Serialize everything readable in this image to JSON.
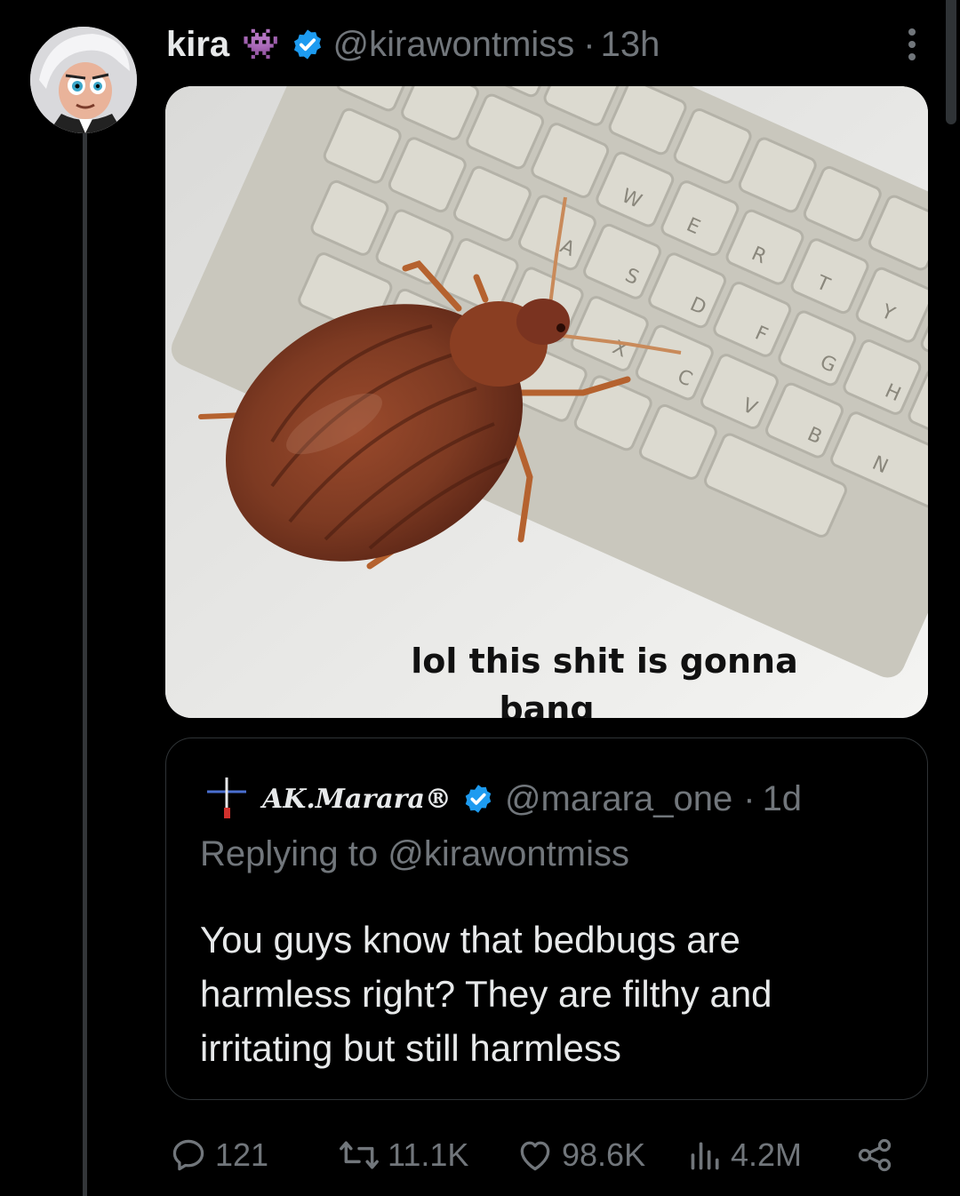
{
  "tweet": {
    "name": "kira",
    "handle": "@kirawontmiss",
    "time_sep": "·",
    "time": "13h",
    "name_emoji": "👾",
    "verified": true,
    "media": {
      "caption_line1": "lol this shit is gonna",
      "caption_line2": "bang"
    }
  },
  "quote": {
    "name": "AK.Marara®",
    "handle": "@marara_one",
    "time_sep": "·",
    "time": "1d",
    "verified": true,
    "replying": "Replying to @kirawontmiss",
    "text": "You guys know that bedbugs are harmless right? They are filthy and irritating but still harmless"
  },
  "actions": {
    "replies": "121",
    "reposts": "11.1K",
    "likes": "98.6K",
    "views": "4.2M"
  },
  "icons": [
    "verified-badge-icon",
    "more-icon",
    "reply-icon",
    "repost-icon",
    "like-icon",
    "views-icon",
    "share-icon"
  ],
  "colors": {
    "background": "#000000",
    "text": "#e7e9ea",
    "muted": "#71767b",
    "verified": "#1d9bf0"
  }
}
